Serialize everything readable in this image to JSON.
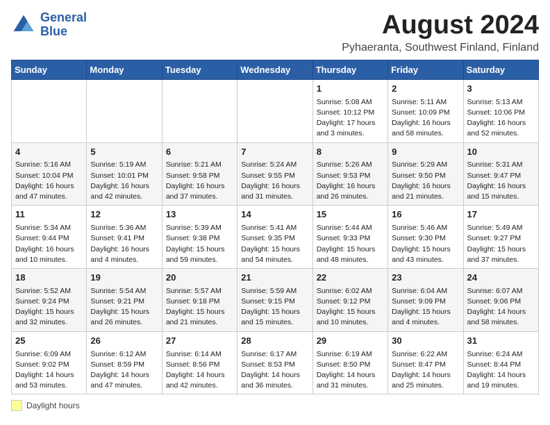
{
  "logo": {
    "line1": "General",
    "line2": "Blue"
  },
  "title": "August 2024",
  "subtitle": "Pyhaeranta, Southwest Finland, Finland",
  "days_of_week": [
    "Sunday",
    "Monday",
    "Tuesday",
    "Wednesday",
    "Thursday",
    "Friday",
    "Saturday"
  ],
  "legend_label": "Daylight hours",
  "weeks": [
    [
      {
        "day": "",
        "info": ""
      },
      {
        "day": "",
        "info": ""
      },
      {
        "day": "",
        "info": ""
      },
      {
        "day": "",
        "info": ""
      },
      {
        "day": "1",
        "info": "Sunrise: 5:08 AM\nSunset: 10:12 PM\nDaylight: 17 hours\nand 3 minutes."
      },
      {
        "day": "2",
        "info": "Sunrise: 5:11 AM\nSunset: 10:09 PM\nDaylight: 16 hours\nand 58 minutes."
      },
      {
        "day": "3",
        "info": "Sunrise: 5:13 AM\nSunset: 10:06 PM\nDaylight: 16 hours\nand 52 minutes."
      }
    ],
    [
      {
        "day": "4",
        "info": "Sunrise: 5:16 AM\nSunset: 10:04 PM\nDaylight: 16 hours\nand 47 minutes."
      },
      {
        "day": "5",
        "info": "Sunrise: 5:19 AM\nSunset: 10:01 PM\nDaylight: 16 hours\nand 42 minutes."
      },
      {
        "day": "6",
        "info": "Sunrise: 5:21 AM\nSunset: 9:58 PM\nDaylight: 16 hours\nand 37 minutes."
      },
      {
        "day": "7",
        "info": "Sunrise: 5:24 AM\nSunset: 9:55 PM\nDaylight: 16 hours\nand 31 minutes."
      },
      {
        "day": "8",
        "info": "Sunrise: 5:26 AM\nSunset: 9:53 PM\nDaylight: 16 hours\nand 26 minutes."
      },
      {
        "day": "9",
        "info": "Sunrise: 5:29 AM\nSunset: 9:50 PM\nDaylight: 16 hours\nand 21 minutes."
      },
      {
        "day": "10",
        "info": "Sunrise: 5:31 AM\nSunset: 9:47 PM\nDaylight: 16 hours\nand 15 minutes."
      }
    ],
    [
      {
        "day": "11",
        "info": "Sunrise: 5:34 AM\nSunset: 9:44 PM\nDaylight: 16 hours\nand 10 minutes."
      },
      {
        "day": "12",
        "info": "Sunrise: 5:36 AM\nSunset: 9:41 PM\nDaylight: 16 hours\nand 4 minutes."
      },
      {
        "day": "13",
        "info": "Sunrise: 5:39 AM\nSunset: 9:38 PM\nDaylight: 15 hours\nand 59 minutes."
      },
      {
        "day": "14",
        "info": "Sunrise: 5:41 AM\nSunset: 9:35 PM\nDaylight: 15 hours\nand 54 minutes."
      },
      {
        "day": "15",
        "info": "Sunrise: 5:44 AM\nSunset: 9:33 PM\nDaylight: 15 hours\nand 48 minutes."
      },
      {
        "day": "16",
        "info": "Sunrise: 5:46 AM\nSunset: 9:30 PM\nDaylight: 15 hours\nand 43 minutes."
      },
      {
        "day": "17",
        "info": "Sunrise: 5:49 AM\nSunset: 9:27 PM\nDaylight: 15 hours\nand 37 minutes."
      }
    ],
    [
      {
        "day": "18",
        "info": "Sunrise: 5:52 AM\nSunset: 9:24 PM\nDaylight: 15 hours\nand 32 minutes."
      },
      {
        "day": "19",
        "info": "Sunrise: 5:54 AM\nSunset: 9:21 PM\nDaylight: 15 hours\nand 26 minutes."
      },
      {
        "day": "20",
        "info": "Sunrise: 5:57 AM\nSunset: 9:18 PM\nDaylight: 15 hours\nand 21 minutes."
      },
      {
        "day": "21",
        "info": "Sunrise: 5:59 AM\nSunset: 9:15 PM\nDaylight: 15 hours\nand 15 minutes."
      },
      {
        "day": "22",
        "info": "Sunrise: 6:02 AM\nSunset: 9:12 PM\nDaylight: 15 hours\nand 10 minutes."
      },
      {
        "day": "23",
        "info": "Sunrise: 6:04 AM\nSunset: 9:09 PM\nDaylight: 15 hours\nand 4 minutes."
      },
      {
        "day": "24",
        "info": "Sunrise: 6:07 AM\nSunset: 9:06 PM\nDaylight: 14 hours\nand 58 minutes."
      }
    ],
    [
      {
        "day": "25",
        "info": "Sunrise: 6:09 AM\nSunset: 9:02 PM\nDaylight: 14 hours\nand 53 minutes."
      },
      {
        "day": "26",
        "info": "Sunrise: 6:12 AM\nSunset: 8:59 PM\nDaylight: 14 hours\nand 47 minutes."
      },
      {
        "day": "27",
        "info": "Sunrise: 6:14 AM\nSunset: 8:56 PM\nDaylight: 14 hours\nand 42 minutes."
      },
      {
        "day": "28",
        "info": "Sunrise: 6:17 AM\nSunset: 8:53 PM\nDaylight: 14 hours\nand 36 minutes."
      },
      {
        "day": "29",
        "info": "Sunrise: 6:19 AM\nSunset: 8:50 PM\nDaylight: 14 hours\nand 31 minutes."
      },
      {
        "day": "30",
        "info": "Sunrise: 6:22 AM\nSunset: 8:47 PM\nDaylight: 14 hours\nand 25 minutes."
      },
      {
        "day": "31",
        "info": "Sunrise: 6:24 AM\nSunset: 8:44 PM\nDaylight: 14 hours\nand 19 minutes."
      }
    ]
  ]
}
